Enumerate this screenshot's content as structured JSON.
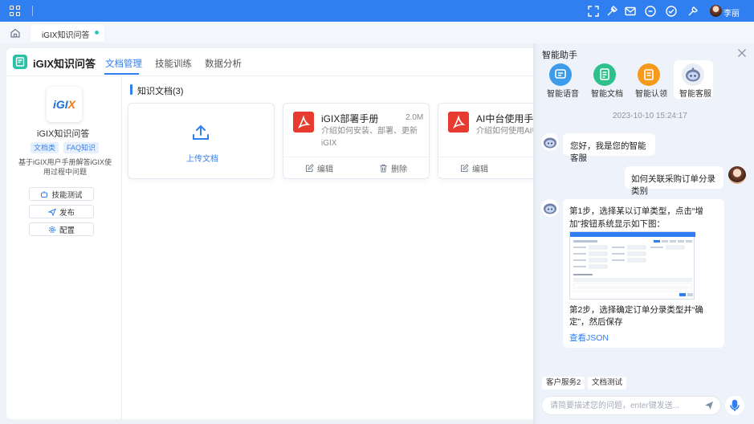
{
  "topbar": {
    "user_name": "李丽",
    "icons": [
      "apps-grid-icon",
      "fullscreen-icon",
      "skin-icon",
      "mail-icon",
      "message-icon",
      "check-circle-icon",
      "tool-icon",
      "avatar"
    ]
  },
  "tabs": {
    "home_icon": "home-icon",
    "active_tab_label": "iGIX知识问答",
    "dot_color": "#37c5b8"
  },
  "app": {
    "title": "iGIX知识问答",
    "nav": [
      "文档管理",
      "技能训练",
      "数据分析"
    ],
    "active_nav_index": 0,
    "accent_color": "#2f7ff0"
  },
  "agent": {
    "logo_text_main": "iGI",
    "logo_text_accent": "X",
    "name": "iGIX知识问答",
    "tags": [
      "文档类",
      "FAQ知识"
    ],
    "description": "基于iGIX用户手册解答iGIX使用过程中问题",
    "buttons": [
      "技能测试",
      "发布",
      "配置"
    ]
  },
  "docs": {
    "section_title": "知识文档(3)",
    "upload_label": "上传文档",
    "items": [
      {
        "title": "iGIX部署手册",
        "size": "2.0M",
        "desc_line1": "介绍如何安装、部署、更新",
        "desc_line2": "iGIX",
        "edit": "编辑",
        "delete": "删除"
      },
      {
        "title": "AI中台使用手册",
        "desc_line1": "介绍如何使用AI中",
        "edit": "编辑"
      }
    ]
  },
  "assistant": {
    "title": "智能助手",
    "modes": [
      "智能语音",
      "智能文档",
      "智能认领",
      "智能客服"
    ],
    "active_mode_index": 3,
    "timestamp": "2023-10-10 15:24:17",
    "messages": {
      "bot_greeting": "您好，我是您的智能客服",
      "user_question": "如何关联采购订单分录类别",
      "bot_step1": "第1步，选择某以订单类型，点击“增加”按钮系统显示如下图：",
      "bot_step2": "第2步，选择确定订单分录类型并“确定”，然后保存",
      "view_json": "查看JSON"
    },
    "quick_chips": [
      "客户服务2",
      "文档测试"
    ],
    "input_placeholder": "请简要描述您的问题，enter键发送..."
  }
}
